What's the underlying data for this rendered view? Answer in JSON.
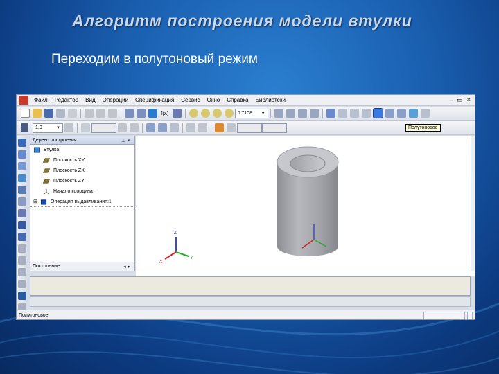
{
  "slide": {
    "title": "Алгоритм построения модели втулки",
    "subtitle": "Переходим в полутоновый режим"
  },
  "menu": [
    "Файл",
    "Редактор",
    "Вид",
    "Операции",
    "Спецификация",
    "Сервис",
    "Окно",
    "Справка",
    "Библиотеки"
  ],
  "toolbar": {
    "zoom_value": "0.7108",
    "step_value": "1.0",
    "fx_label": "f(x)",
    "tooltip": "Полутоновое"
  },
  "tree": {
    "title": "Дерево построения",
    "root": "Втулка",
    "items": [
      "Плоскость XY",
      "Плоскость ZX",
      "Плоскость ZY",
      "Начало координат",
      "Операция выдавливания:1"
    ],
    "tab_label": "Построение"
  },
  "axes": {
    "x": "X",
    "y": "Y",
    "z": "Z"
  },
  "status": {
    "text": "Полутоновое"
  },
  "colors": {
    "accent": "#1a5fb0",
    "tooltip_bg": "#ffffe1"
  }
}
